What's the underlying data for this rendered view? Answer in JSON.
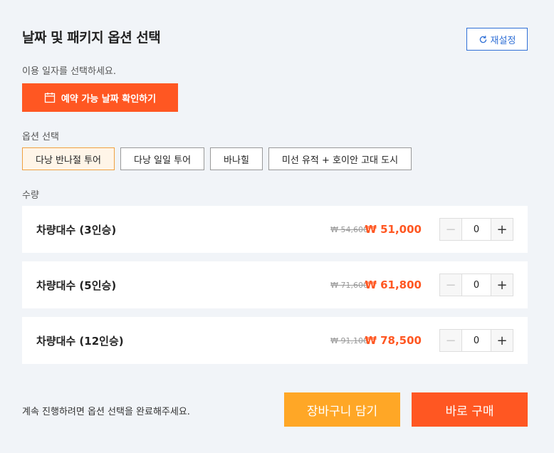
{
  "header": {
    "title": "날짜 및 패키지 옵션 선택",
    "reset_label": "재설정"
  },
  "date": {
    "label": "이용 일자를 선택하세요.",
    "button_label": "예약 가능 날짜 확인하기"
  },
  "options": {
    "label": "옵션 선택",
    "items": [
      {
        "label": "다낭 반나절 투어",
        "selected": true
      },
      {
        "label": "다낭 일일 투어",
        "selected": false
      },
      {
        "label": "바나힐",
        "selected": false
      },
      {
        "label": "미선 유적 + 호이안 고대 도시",
        "selected": false
      }
    ]
  },
  "quantity": {
    "label": "수량",
    "rows": [
      {
        "name": "차량대수 (3인승)",
        "old_price": "₩ 54,600",
        "price": "₩ 51,000",
        "qty": "0"
      },
      {
        "name": "차량대수 (5인승)",
        "old_price": "₩ 71,600",
        "price": "₩ 61,800",
        "qty": "0"
      },
      {
        "name": "차량대수 (12인승)",
        "old_price": "₩ 91,100",
        "price": "₩ 78,500",
        "qty": "0"
      }
    ],
    "minus_symbol": "−",
    "plus_symbol": "+"
  },
  "footer": {
    "note": "계속 진행하려면 옵션 선택을 완료해주세요.",
    "cart_label": "장바구니 담기",
    "buy_label": "바로 구매"
  },
  "colors": {
    "accent": "#ff5722",
    "cart": "#ffa726",
    "link": "#2f6fd6"
  }
}
